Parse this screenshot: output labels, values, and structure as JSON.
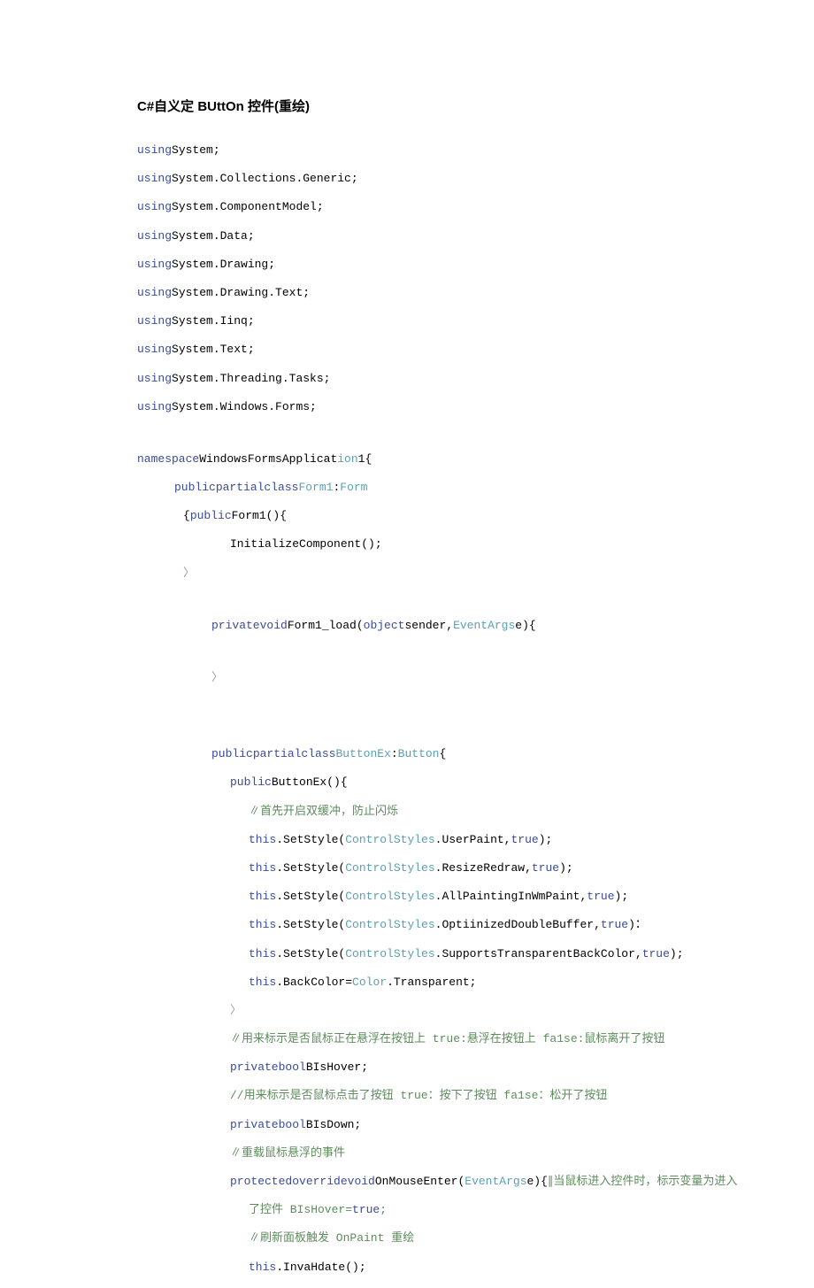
{
  "title": "C#自义定 BUttOn 控件(重绘)",
  "lines": {
    "u1": "System;",
    "u2": "System.Collections.Generic;",
    "u3": "System.ComponentModel;",
    "u4": "System.Data;",
    "u5": "System.Drawing;",
    "u6": "System.Drawing.Text;",
    "u7": "System.Iinq;",
    "u8": "System.Text;",
    "u9": "System.Threading.Tasks;",
    "u10": "System.Windows.Forms;",
    "ns": "WindowsFormsApplicat",
    "nsEnd": "1{",
    "form1": "Form1",
    "formBase": "Form",
    "formCtor": "Form1(){",
    "init": "InitializeComponent();",
    "loadSig1": "Form1_load(",
    "loadSig2": "sender,",
    "loadSig3": "e){",
    "btnex": "ButtonEx",
    "btnexBase": "Button",
    "btnexCtor": "ButtonEx(){",
    "c1": "∥首先开启双缓冲，防止闪烁",
    "s1a": ".SetStyle(",
    "s1b": ".UserPaint,",
    "s2b": ".ResizeRedraw,",
    "s3b": ".AllPaintingInWmPaint,",
    "s4b": ".OptiinizedDoubleBuffer,",
    "s5b": ".SupportsTransparentBackColor,",
    "bc": ".BackColor=",
    "bcv": ".Transparent;",
    "c2": "∥用来标示是否鼠标正在悬浮在按钮上 true:悬浮在按钮上 fa1se:鼠标离开了按钮",
    "pb1": "BIsHover;",
    "c3": "//用来标示是否鼠标点击了按钮 true：按下了按钮 fa1se：松开了按钮",
    "pb2": "BIsDown;",
    "c4": "∥重载鼠标悬浮的事件",
    "ome1": "OnMouseEnter(",
    "ome2": "e){",
    "ome3": "∥当鼠标进入控件时，标示变量为进入",
    "ome4": "了控件 BIsHover=",
    "c5": "∥刷新面板触发 OnPaint 重绘",
    "inv": ".InvaHdate();",
    "kw_using": "using",
    "kw_namespace": "namespace",
    "kw_public": "public",
    "kw_private": "private",
    "kw_partial": "partial",
    "kw_class": "class",
    "kw_void": "void",
    "kw_object": "object",
    "kw_this": "this",
    "kw_true": "true",
    "kw_bool": "bool",
    "kw_protected": "protected",
    "kw_override": "override",
    "t_ion": "ion",
    "t_ControlStyles": "ControlStyles",
    "t_EventArgs": "EventArgs",
    "t_Color": "Color",
    "close_brace": "}",
    "close_brace_angle": "〉",
    "open_brace": "{",
    "semi": ";",
    "paren": "){",
    "colon": ":",
    "obrace_public": "{public",
    "obrace_only": "{"
  }
}
